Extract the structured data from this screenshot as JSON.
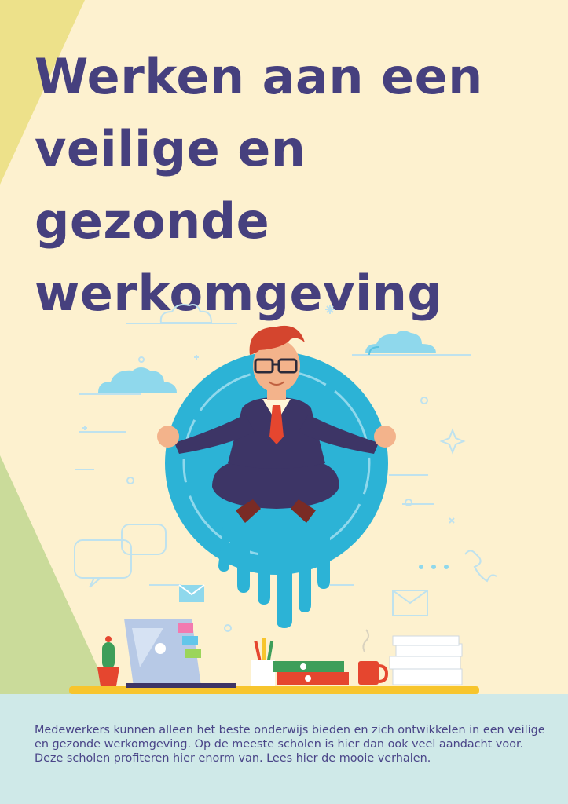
{
  "page": {
    "title_lines": [
      "Werken aan een",
      "veilige en",
      "gezonde",
      "werkomgeving"
    ],
    "intro_text": "Medewerkers kunnen alleen het beste onderwijs bieden en zich ontwikkelen in een veilige en gezonde werkomgeving. Op de meeste scholen is hier dan ook veel aandacht voor. Deze scholen profiteren hier enorm van. Lees hier de mooie verhalen."
  },
  "colors": {
    "background": "#fdf1cf",
    "title": "#46407e",
    "body_text": "#4a4588",
    "footer_band": "#cfe9e8",
    "accent_circle": "#2cb3d6",
    "suit": "#3d3566",
    "tie": "#e5462f",
    "desk": "#f7c52d"
  },
  "illustration": {
    "subject": "meditating-businessman",
    "icons": [
      "cloud-icon",
      "chat-bubble-icon",
      "envelope-icon",
      "phone-icon",
      "sparkle-icon",
      "cactus-icon",
      "laptop-icon",
      "pencil-cup-icon",
      "binders-icon",
      "mug-icon",
      "paper-stack-icon"
    ]
  }
}
